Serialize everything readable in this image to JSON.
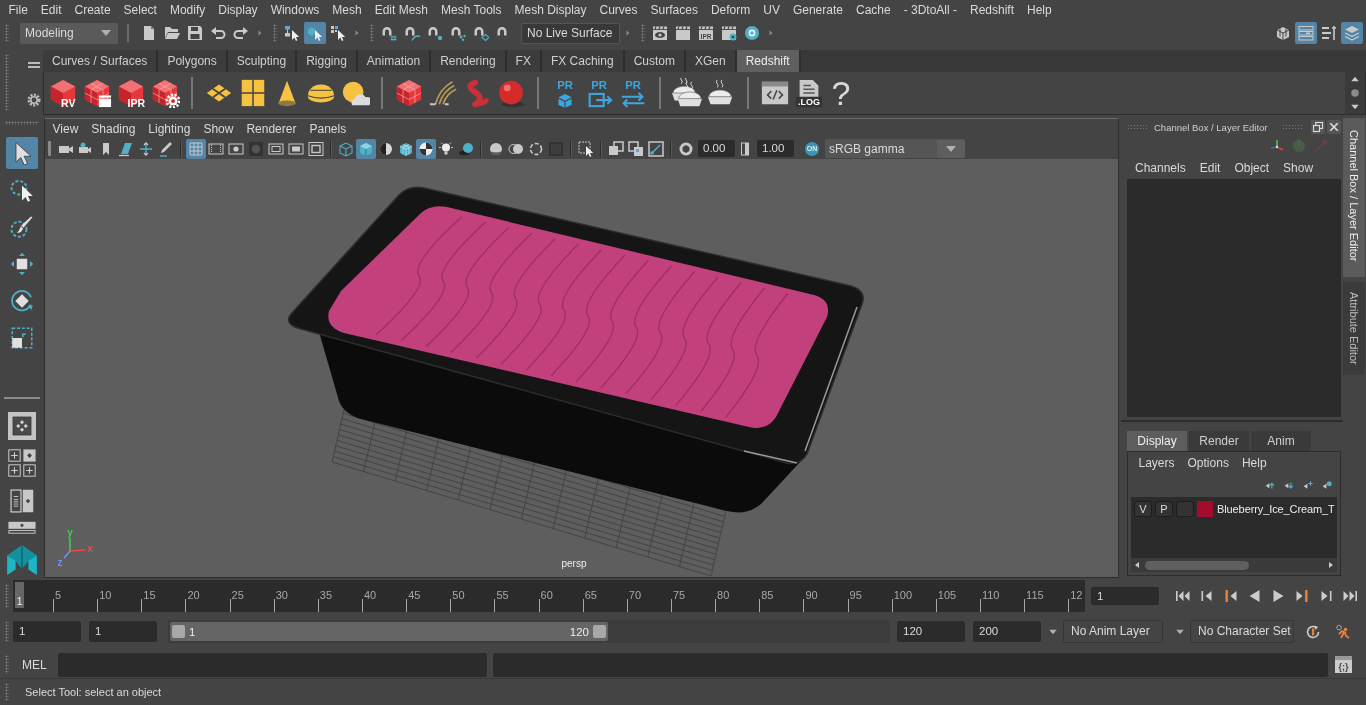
{
  "menu_bar": [
    "File",
    "Edit",
    "Create",
    "Select",
    "Modify",
    "Display",
    "Windows",
    "Mesh",
    "Edit Mesh",
    "Mesh Tools",
    "Mesh Display",
    "Curves",
    "Surfaces",
    "Deform",
    "UV",
    "Generate",
    "Cache",
    "- 3DtoAll -",
    "Redshift",
    "Help"
  ],
  "status_line": {
    "mode": "Modeling",
    "file_tools": [
      {
        "kind": "new-scene"
      },
      {
        "kind": "open-scene"
      },
      {
        "kind": "save-scene"
      },
      {
        "kind": "undo"
      },
      {
        "kind": "redo"
      }
    ],
    "selection_modes": [
      {
        "kind": "select-hierarchy",
        "selected": false
      },
      {
        "kind": "select-object",
        "selected": true
      },
      {
        "kind": "select-component",
        "selected": false
      }
    ],
    "snap_tools": [
      {
        "kind": "snap-grid"
      },
      {
        "kind": "snap-curve"
      },
      {
        "kind": "snap-point"
      },
      {
        "kind": "snap-view"
      },
      {
        "kind": "snap-surface"
      },
      {
        "kind": "snap-live"
      }
    ],
    "live_surface": "No Live Surface",
    "render_tools": [
      {
        "kind": "render-view"
      },
      {
        "kind": "render"
      },
      {
        "kind": "ipr-render",
        "label": "IPR"
      },
      {
        "kind": "render-settings"
      },
      {
        "kind": "hypershade"
      }
    ],
    "panel_toggles": [
      {
        "kind": "modeling-toolkit",
        "on": false
      },
      {
        "kind": "attribute-editor",
        "on": true
      },
      {
        "kind": "tool-settings",
        "on": false
      },
      {
        "kind": "channel-box",
        "on": true
      }
    ]
  },
  "shelf": {
    "tabs": [
      {
        "label": "Curves / Surfaces",
        "selected": false
      },
      {
        "label": "Polygons",
        "selected": false
      },
      {
        "label": "Sculpting",
        "selected": false
      },
      {
        "label": "Rigging",
        "selected": false
      },
      {
        "label": "Animation",
        "selected": false
      },
      {
        "label": "Rendering",
        "selected": false
      },
      {
        "label": "FX",
        "selected": false
      },
      {
        "label": "FX Caching",
        "selected": false
      },
      {
        "label": "Custom",
        "selected": false
      },
      {
        "label": "XGen",
        "selected": false
      },
      {
        "label": "Redshift",
        "selected": true
      }
    ],
    "groups": [
      [
        {
          "kind": "rs-cube",
          "label": "RV"
        },
        {
          "kind": "rs-cube-clapper"
        },
        {
          "kind": "rs-cube",
          "label": "IPR"
        },
        {
          "kind": "rs-cube-gear"
        }
      ],
      [
        {
          "kind": "tiles-diamond"
        },
        {
          "kind": "tiles-grid"
        },
        {
          "kind": "cone"
        },
        {
          "kind": "dome"
        },
        {
          "kind": "sun-cloud"
        }
      ],
      [
        {
          "kind": "cube-grid"
        },
        {
          "kind": "strands"
        },
        {
          "kind": "worm"
        },
        {
          "kind": "ball"
        }
      ],
      [
        {
          "kind": "pr-box",
          "label": "PR"
        },
        {
          "kind": "pr-export",
          "label": "PR"
        },
        {
          "kind": "pr-swap",
          "label": "PR"
        }
      ],
      [
        {
          "kind": "pie-stack"
        },
        {
          "kind": "pie"
        }
      ],
      [
        {
          "kind": "code-window"
        },
        {
          "kind": "log-file",
          "label": ".LOG"
        },
        {
          "kind": "help",
          "label": "?"
        }
      ]
    ]
  },
  "toolbox": {
    "tools": [
      {
        "kind": "select",
        "selected": true
      },
      {
        "kind": "lasso",
        "selected": false
      },
      {
        "kind": "paint",
        "selected": false
      },
      {
        "kind": "move",
        "selected": false
      },
      {
        "kind": "rotate",
        "selected": false
      },
      {
        "kind": "scale",
        "selected": false
      }
    ],
    "layouts": [
      {
        "kind": "single-pane",
        "selected": true
      },
      {
        "kind": "plus-pane",
        "selected": false
      },
      {
        "kind": "diamond-pane",
        "selected": false
      },
      {
        "kind": "plus-pane",
        "selected": false
      },
      {
        "kind": "plus-pane",
        "selected": false
      },
      {
        "kind": "outliner-persp",
        "selected": false
      },
      {
        "kind": "persp-stack",
        "selected": false
      }
    ]
  },
  "viewport": {
    "menu": [
      "View",
      "Shading",
      "Lighting",
      "Show",
      "Renderer",
      "Panels"
    ],
    "camera_tools": [
      {
        "kind": "camera"
      },
      {
        "kind": "camera-attributes"
      },
      {
        "kind": "bookmark"
      },
      {
        "kind": "image-plane"
      },
      {
        "kind": "pan-zoom"
      },
      {
        "kind": "grease-pencil"
      }
    ],
    "toolbar": [
      [
        {
          "kind": "grid",
          "on": true
        },
        {
          "kind": "film-gate",
          "on": false
        },
        {
          "kind": "resolution-gate",
          "on": false
        },
        {
          "kind": "gate-mask",
          "on": false
        },
        {
          "kind": "field-chart",
          "on": false
        },
        {
          "kind": "safe-action",
          "on": false
        },
        {
          "kind": "safe-title",
          "on": false
        }
      ],
      [
        {
          "kind": "wireframe",
          "on": false
        },
        {
          "kind": "smooth-shade",
          "on": true
        },
        {
          "kind": "default-material",
          "on": false
        },
        {
          "kind": "wireframe-on-shaded",
          "on": false
        },
        {
          "kind": "textured",
          "on": true
        },
        {
          "kind": "lights",
          "on": false
        },
        {
          "kind": "shadows",
          "on": false
        }
      ],
      [
        {
          "kind": "ambient-occlusion",
          "on": false
        },
        {
          "kind": "motion-blur",
          "on": false
        },
        {
          "kind": "anti-aliasing",
          "on": false
        },
        {
          "kind": "depth-of-field",
          "on": false
        }
      ],
      [
        {
          "kind": "isolate-select",
          "on": false
        }
      ],
      [
        {
          "kind": "xray",
          "on": false
        },
        {
          "kind": "xray-active",
          "on": false
        },
        {
          "kind": "xray-joints",
          "on": false
        }
      ]
    ],
    "exposure": "0.00",
    "gamma": "1.00",
    "color_management": {
      "label": "ON",
      "on": true
    },
    "view_transform": "sRGB gamma",
    "axes": [
      {
        "label": "y",
        "color": "#3fd04a"
      },
      {
        "label": "x",
        "color": "#f04848"
      },
      {
        "label": "z",
        "color": "#7090ff"
      }
    ],
    "camera": "persp"
  },
  "channel_box": {
    "title": "Channel Box / Layer Editor",
    "menu": [
      "Channels",
      "Edit",
      "Object",
      "Show"
    ],
    "layer_tabs": [
      {
        "label": "Display",
        "selected": true
      },
      {
        "label": "Render",
        "selected": false
      },
      {
        "label": "Anim",
        "selected": false
      }
    ],
    "layer_menu": [
      "Layers",
      "Options",
      "Help"
    ],
    "layers": [
      {
        "visibility": "V",
        "playback": "P",
        "color": "#a20d2c",
        "name": "Blueberry_Ice_Cream_T"
      }
    ]
  },
  "side_tabs": [
    {
      "label": "Channel Box / Layer Editor",
      "selected": true
    },
    {
      "label": "Attribute Editor",
      "selected": false
    }
  ],
  "timeline": {
    "current_frame": "1",
    "ticks": [
      "5",
      "10",
      "15",
      "20",
      "25",
      "30",
      "35",
      "40",
      "45",
      "50",
      "55",
      "60",
      "65",
      "70",
      "75",
      "80",
      "85",
      "90",
      "95",
      "100",
      "105",
      "110",
      "115",
      "12"
    ],
    "frame": "1"
  },
  "range": {
    "start": "1",
    "playback_start": "1",
    "slider_start": "1",
    "slider_end": "120",
    "level": 0.61,
    "playback_end": "120",
    "end": "200",
    "anim_layer": "No Anim Layer",
    "character_set": "No Character Set"
  },
  "command_line": {
    "language": "MEL",
    "script_editor": "{;}"
  },
  "help_line": "Select Tool: select an object"
}
